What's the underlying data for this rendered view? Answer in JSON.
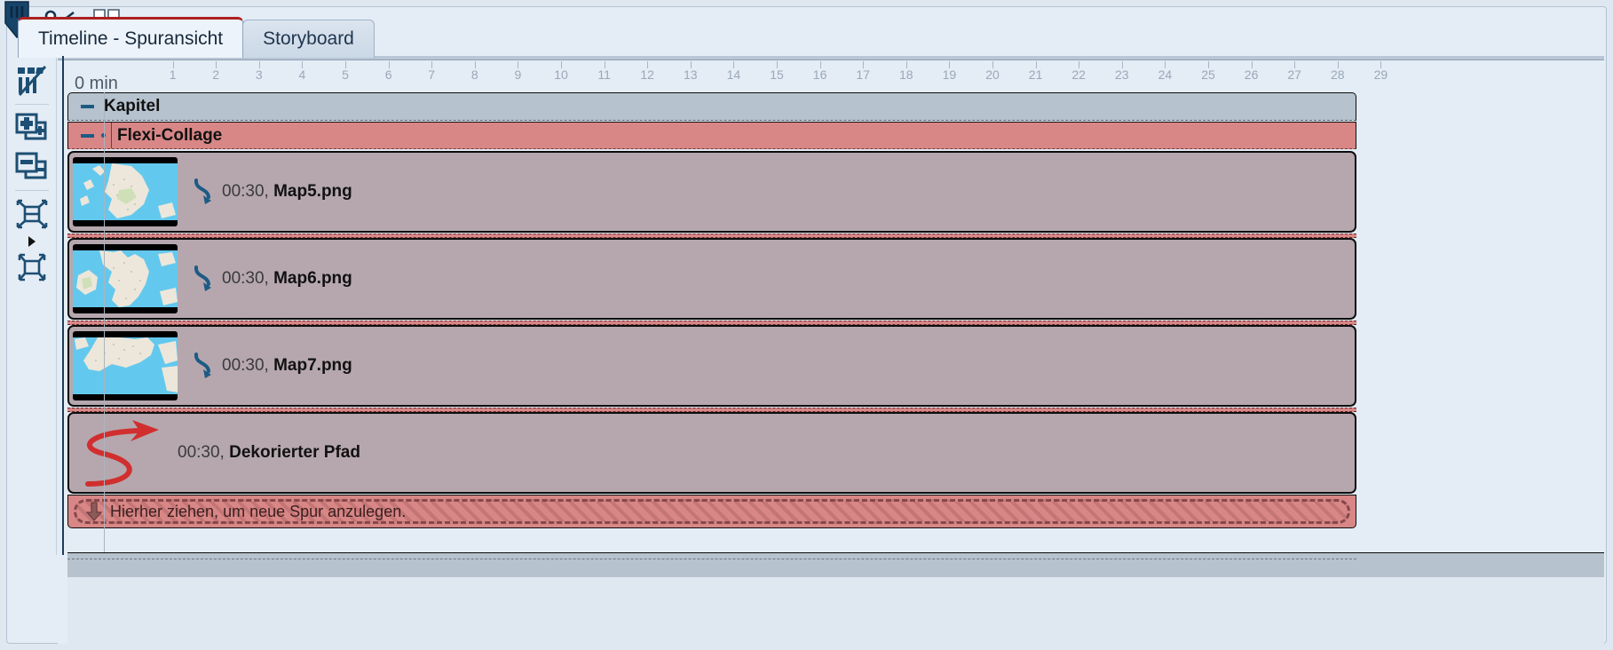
{
  "window": {
    "title": "Timeline - Spuransicht"
  },
  "tabs": [
    {
      "label": "Timeline - Spuransicht",
      "active": true,
      "name": "tab-timeline"
    },
    {
      "label": "Storyboard",
      "active": false,
      "name": "tab-storyboard"
    }
  ],
  "toolbar": {
    "items": [
      {
        "name": "toggle-waveform-icon",
        "title": "Wellenform ein/aus"
      },
      {
        "name": "add-track-icon",
        "title": "Spur hinzufuegen"
      },
      {
        "name": "remove-track-icon",
        "title": "Spur entfernen"
      },
      {
        "name": "fit-selection-icon",
        "title": "Auswahl einpassen"
      },
      {
        "name": "expand-caret-icon",
        "title": "Mehr"
      },
      {
        "name": "fit-all-icon",
        "title": "Alles einpassen"
      }
    ]
  },
  "ruler": {
    "zero_label": "0 min",
    "unit": "min",
    "ticks": [
      1,
      2,
      3,
      4,
      5,
      6,
      7,
      8,
      9,
      10,
      11,
      12,
      13,
      14,
      15,
      16,
      17,
      18,
      19,
      20,
      21,
      22,
      23,
      24,
      25,
      26,
      27,
      28,
      29
    ],
    "playhead_icon": "playhead-marker-icon",
    "cut_icon": "scissors-icon",
    "split_icon": "split-marker-icon",
    "playhead_position_label": "0 min"
  },
  "timeline": {
    "chapter": {
      "label": "Kapitel",
      "collapse_icon": "minus-icon",
      "color": "#b6c2ce"
    },
    "collage": {
      "label": "Flexi-Collage",
      "collapse_icon": "minus-icon",
      "bullet_icon": "dot-icon",
      "color": "#d88686"
    },
    "clips": [
      {
        "duration": "00:30,",
        "name": "Map5.png",
        "icon": "loop-arrow-icon",
        "thumbnail": "map-scotland-thumbnail"
      },
      {
        "duration": "00:30,",
        "name": "Map6.png",
        "icon": "loop-arrow-icon",
        "thumbnail": "map-britain-north-thumbnail"
      },
      {
        "duration": "00:30,",
        "name": "Map7.png",
        "icon": "loop-arrow-icon",
        "thumbnail": "map-britain-south-thumbnail"
      },
      {
        "duration": "00:30,",
        "name": "Dekorierter Pfad",
        "icon": "decorated-path-icon",
        "thumbnail": null
      }
    ],
    "dropzone": {
      "label": "Hierher ziehen, um neue Spur anzulegen.",
      "icon": "down-arrow-icon"
    }
  },
  "colors": {
    "accent_red": "#ad2020",
    "track_header": "#b6c2ce",
    "collage_band": "#d88686",
    "clip_body": "#b6a7ae",
    "icon_blue": "#1d5b85",
    "path_red": "#d12f2f"
  }
}
